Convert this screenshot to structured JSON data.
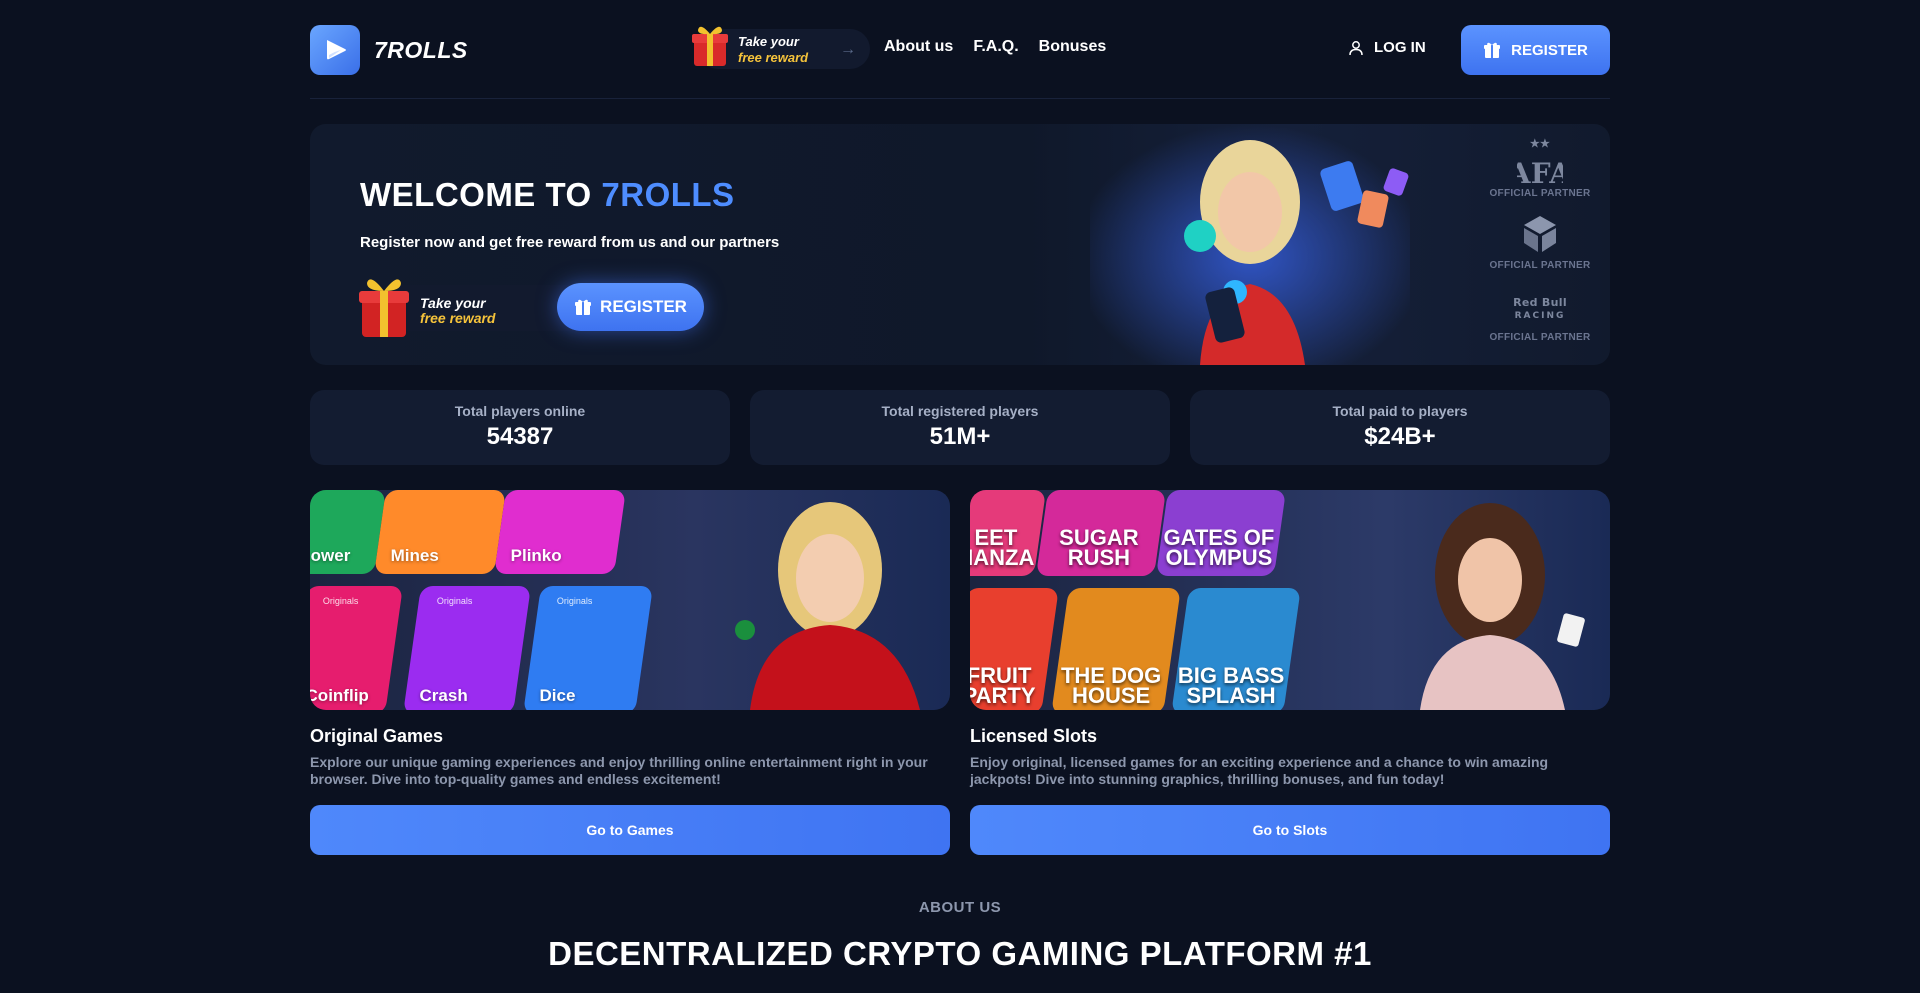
{
  "header": {
    "logo_text": "7ROLLS",
    "reward_line1": "Take your",
    "reward_line2": "free reward",
    "nav": [
      "About us",
      "F.A.Q.",
      "Bonuses"
    ],
    "login_label": "LOG IN",
    "register_label": "REGISTER"
  },
  "hero": {
    "title_prefix": "WELCOME TO ",
    "title_accent": "7ROLLS",
    "subtitle": "Register now and get free reward from us and our partners",
    "reward_line1": "Take your",
    "reward_line2": "free reward",
    "register_label": "REGISTER",
    "partners": [
      {
        "name": "AFA",
        "label": "OFFICIAL PARTNER"
      },
      {
        "name": "cube",
        "label": "OFFICIAL PARTNER"
      },
      {
        "name": "Red Bull RACING",
        "label": "OFFICIAL PARTNER"
      }
    ]
  },
  "stats": [
    {
      "label": "Total players online",
      "value": "54387"
    },
    {
      "label": "Total registered players",
      "value": "51M+"
    },
    {
      "label": "Total paid to players",
      "value": "$24B+"
    }
  ],
  "cards": [
    {
      "title": "Original Games",
      "desc": "Explore our unique gaming experiences and enjoy thrilling online entertainment right in your browser. Dive into top-quality games and endless excitement!",
      "button": "Go to Games",
      "tiles": [
        "ower",
        "Mines",
        "Plinko",
        "Coinflip",
        "Crash",
        "Dice"
      ],
      "originals_label": "Originals"
    },
    {
      "title": "Licensed Slots",
      "desc": "Enjoy original, licensed games for an exciting experience and a chance to win amazing jackpots! Dive into stunning graphics, thrilling bonuses, and fun today!",
      "button": "Go to Slots",
      "tiles": [
        "EET NANZA",
        "SUGAR RUSH",
        "GATES OF OLYMPUS",
        "FRUIT PARTY",
        "THE DOG HOUSE",
        "BIG BASS SPLASH"
      ]
    }
  ],
  "about": {
    "label": "ABOUT US",
    "title": "DECENTRALIZED CRYPTO GAMING PLATFORM #1"
  },
  "colors": {
    "background": "#0b1120",
    "accent": "#4e8dff",
    "reward_yellow": "#f5c33b"
  }
}
